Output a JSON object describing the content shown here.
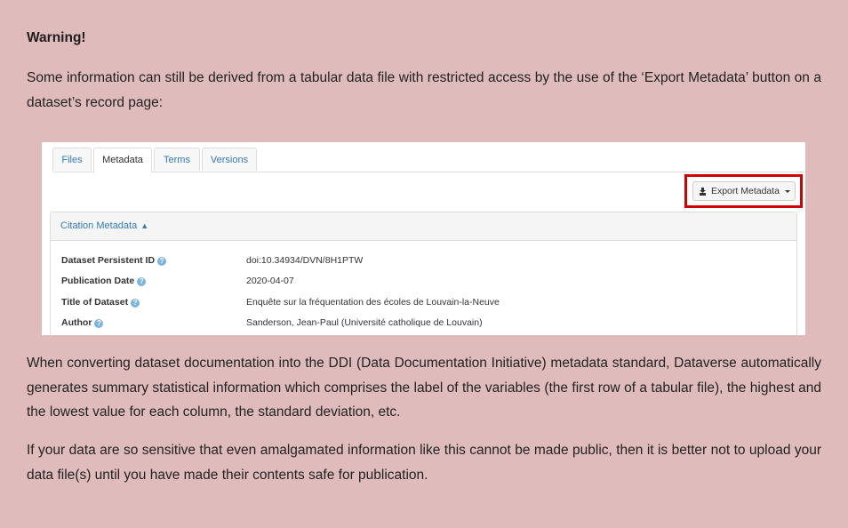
{
  "warning": {
    "title": "Warning!",
    "paragraph1": "Some information can still be derived from a tabular data file with restricted access by the use of the ‘Export Metadata’ button on a dataset’s record page:",
    "paragraph2": "When converting dataset documentation into the DDI (Data Documentation Initiative) metadata standard, Dataverse automatically generates summary statistical information which comprises the label of the variables (the first row of a tabular file), the highest and the lowest value for each column, the standard deviation, etc.",
    "paragraph3": "If your data are so sensitive that even amalgamated information like this cannot be made public, then it is better not to upload your data file(s) until you have made their contents safe for publication."
  },
  "screenshot": {
    "tabs": [
      {
        "label": "Files"
      },
      {
        "label": "Metadata"
      },
      {
        "label": "Terms"
      },
      {
        "label": "Versions"
      }
    ],
    "active_tab": "Metadata",
    "export_button_label": "Export Metadata",
    "highlight_color": "#d00000",
    "panel_title": "Citation Metadata",
    "metadata": [
      {
        "label": "Dataset Persistent ID",
        "value": "doi:10.34934/DVN/8H1PTW"
      },
      {
        "label": "Publication Date",
        "value": "2020-04-07"
      },
      {
        "label": "Title of Dataset",
        "value": "Enquête sur la fréquentation des écoles de Louvain-la-Neuve"
      },
      {
        "label": "Author",
        "value": "Sanderson, Jean-Paul (Université catholique de Louvain)"
      }
    ]
  }
}
